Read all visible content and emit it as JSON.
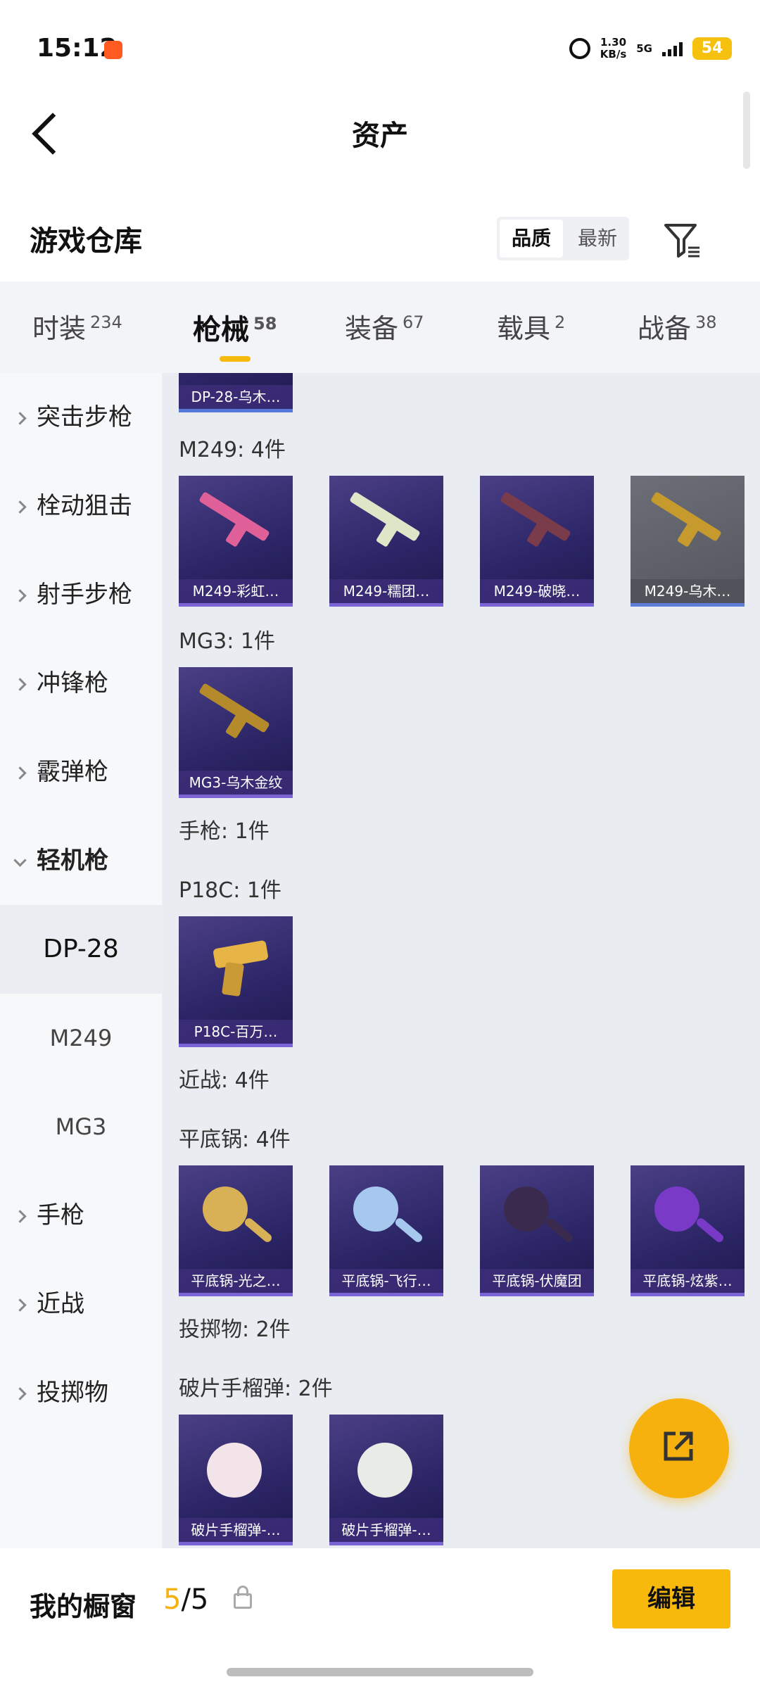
{
  "status_bar": {
    "time": "15:12",
    "speed": "1.30",
    "speed_unit": "KB/s",
    "network": "5G",
    "battery": "54"
  },
  "header": {
    "title": "资产"
  },
  "warehouse": {
    "heading": "游戏仓库",
    "sort_options": [
      "品质",
      "最新"
    ],
    "sort_selected": "品质"
  },
  "tabs": [
    {
      "label": "时装",
      "count": "234"
    },
    {
      "label": "枪械",
      "count": "58",
      "active": true
    },
    {
      "label": "装备",
      "count": "67"
    },
    {
      "label": "载具",
      "count": "2"
    },
    {
      "label": "战备",
      "count": "38"
    }
  ],
  "sidebar": {
    "items": [
      {
        "label": "突击步枪"
      },
      {
        "label": "栓动狙击"
      },
      {
        "label": "射手步枪"
      },
      {
        "label": "冲锋枪"
      },
      {
        "label": "霰弹枪"
      },
      {
        "label": "轻机枪",
        "expanded": true
      },
      {
        "label": "DP-28",
        "selected": true
      },
      {
        "label": "M249"
      },
      {
        "label": "MG3"
      },
      {
        "label": "手枪"
      },
      {
        "label": "近战"
      },
      {
        "label": "投掷物"
      }
    ]
  },
  "content": {
    "partial_item": "DP-28-乌木…",
    "sections": [
      {
        "title": "M249: 4件",
        "items": [
          "M249-彩虹…",
          "M249-糯团…",
          "M249-破晓…",
          "M249-乌木…"
        ]
      },
      {
        "title": "MG3: 1件",
        "items": [
          "MG3-乌木金纹"
        ]
      },
      {
        "title": "手枪: 1件"
      },
      {
        "title": "P18C: 1件",
        "items": [
          "P18C-百万…"
        ]
      },
      {
        "title": "近战: 4件"
      },
      {
        "title": "平底锅: 4件",
        "items": [
          "平底锅-光之…",
          "平底锅-飞行…",
          "平底锅-伏魔团",
          "平底锅-炫紫…"
        ]
      },
      {
        "title": "投掷物: 2件"
      },
      {
        "title": "破片手榴弹: 2件",
        "items": [
          "破片手榴弹-…",
          "破片手榴弹-…"
        ]
      }
    ]
  },
  "showcase": {
    "label": "我的橱窗",
    "current": "5",
    "total": "/5",
    "edit_label": "编辑"
  },
  "colors": {
    "accent": "#f6b90c",
    "card_purple": "#2b2566"
  },
  "icons": [
    "back-arrow-icon",
    "filter-icon",
    "share-icon",
    "lock-icon",
    "alarm-icon"
  ]
}
